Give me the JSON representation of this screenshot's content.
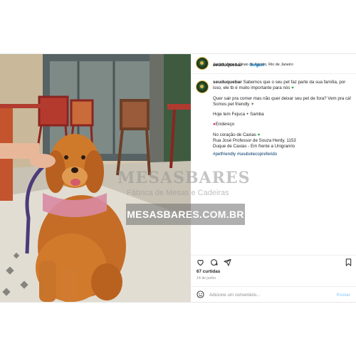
{
  "post": {
    "username": "seuduquebar",
    "dot": "•",
    "follow_label": "Seguir",
    "location": "Jardim Vinte e Cinco de Agosto, Rio de Janeiro",
    "caption_lead": "Sabemos que o seu pet faz parte da sua família, por isso, ele tb é muito importante para nós",
    "caption_p2": "Quer sair pra comer mas não quer deixar seu pet de fora? Vem pra cá! Somos pet friendly",
    "caption_p3": "Hoje tem Fejuca + Samba",
    "caption_p4": "Endereço",
    "caption_p5a": "No coração de Caxias",
    "caption_p5b": "Rua José Professor de Souza Herdy, 1153",
    "caption_p5c": "Duque de Caxias - Em frente a Unigranrio",
    "hashtags": "#petfriendly #seubotecopreferido",
    "likes": "67 curtidas",
    "date": "14 de junho",
    "comment_placeholder": "Adicione um comentário...",
    "post_label": "Postar"
  },
  "watermark": {
    "brand": "MESASBARES",
    "tagline": "Fábrica de Mesas e Cadeiras",
    "url": "MESASBARES.COM.BR"
  },
  "icons": {
    "heart": "green-heart-icon",
    "pin": "pin-icon",
    "emoji": "emoji-icon",
    "like": "heart-outline-icon",
    "comment": "comment-icon",
    "share": "share-icon",
    "save": "bookmark-icon"
  },
  "colors": {
    "accent": "#0095f6",
    "muted": "#8e8e8e",
    "heart": "#21a344"
  }
}
